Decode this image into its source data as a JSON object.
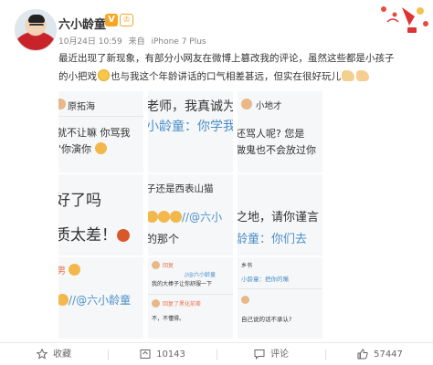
{
  "post": {
    "author": "六小龄童",
    "badge_v": "V",
    "badge_vip": "♔",
    "date": "10月24日 10:59",
    "source_prefix": "来自",
    "source": "iPhone 7 Plus",
    "text_line1": "最近出现了新现象，有部分小网友在微博上篡改我的评论，虽然这些都是小孩子",
    "text_line2_a": "的小把戏",
    "text_line2_b": "也与我这个年龄讲话的口气相差甚远，但实在很好玩儿"
  },
  "grid": {
    "t1": {
      "l1": "原拓海",
      "l2": "就不让嘛 你骂我",
      "l3": "\"你演你"
    },
    "t2": {
      "l1": "老师，我真诚为",
      "l2": "小龄童：你学我"
    },
    "t3": {
      "l1": "小地才",
      "l2": "还骂人呢? 您是",
      "l3": "做鬼也不会放过你"
    },
    "t4": {
      "l1": "好了吗",
      "l2": "质太差！"
    },
    "t5": {
      "l1": "子还是西表山猫",
      "l2": "//@六小",
      "l3": "的那个"
    },
    "t6": {
      "l1": "之地，请你谨言",
      "l2": "龄童：你们去"
    },
    "t7": {
      "l1": "男",
      "l2": "//@六小龄童"
    },
    "t8": {
      "l1": "回复",
      "l2": "//@六小龄童",
      "l3": "我的大棒子让你舒服一下",
      "l4": "回复了黑化前辈",
      "l5": "不，不懂得。"
    },
    "t9": {
      "l1": "乡书",
      "l2": "小龄童：把你的嘴",
      "l3": "自己说的话不承认?"
    }
  },
  "footer": {
    "favorite": "收藏",
    "repost": "10143",
    "comment": "评论",
    "like": "57447"
  },
  "colors": {
    "link_blue": "#4a90c9",
    "badge_orange": "#f5a623",
    "text": "#333333",
    "meta": "#808080"
  },
  "icons": [
    "star-icon",
    "repost-icon",
    "comment-icon",
    "like-icon",
    "verified-badge-icon"
  ]
}
